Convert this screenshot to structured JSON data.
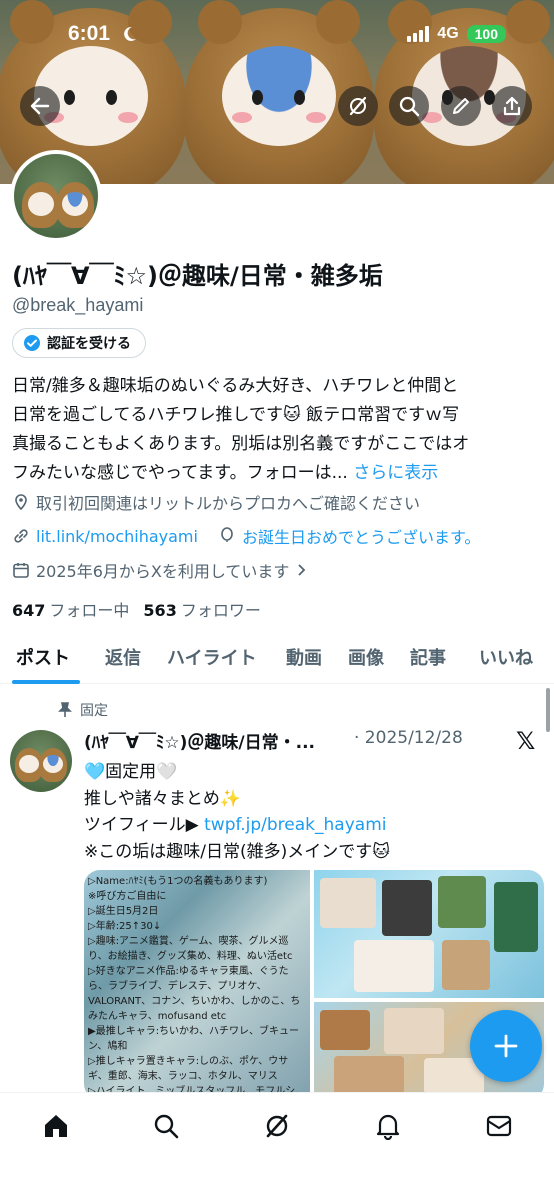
{
  "status_bar": {
    "time": "6:01",
    "network": "4G",
    "battery": "100"
  },
  "banner": {
    "icons": [
      "back-arrow-icon",
      "grok-icon",
      "search-icon",
      "edit-pencil-icon",
      "share-icon"
    ]
  },
  "profile": {
    "display_name": "(ﾊﾔ￣∀￣ﾐ☆)＠趣味/日常・雑多垢",
    "handle": "@break_hayami",
    "verify_label": "認証を受ける",
    "bio_lines": [
      "日常/雑多＆趣味垢のぬいぐるみ大好き、ハチワレと仲間と",
      "日常を過ごしてるハチワレ推しです🐱 飯テロ常習ですｗ写",
      "真撮ることもよくあります。別垢は別名義ですがここではオ",
      "フみたいな感じでやってます。フォローは..."
    ],
    "bio_more": "さらに表示",
    "location": "取引初回関連はリットルからプロカへご確認ください",
    "website": "lit.link/mochihayami",
    "birthday": "お誕生日おめでとうございます。",
    "joined": "2025年6月からXを利用しています",
    "following_count": "647",
    "following_label": "フォロー中",
    "followers_count": "563",
    "followers_label": "フォロワー"
  },
  "tabs": [
    "ポスト",
    "返信",
    "ハイライト",
    "動画",
    "画像",
    "記事",
    "いいね"
  ],
  "post": {
    "pinned_label": "固定",
    "author": "(ﾊﾔ￣∀￣ﾐ☆)＠趣味/日常・...",
    "date": "· 2025/12/28",
    "x_logo": "𝕏",
    "lines": [
      "🩵固定用🤍",
      "推しや諸々まとめ✨",
      "ツイフィール▶ "
    ],
    "twpf_link": "twpf.jp/break_hayami",
    "last_line": "※この垢は趣味/日常(雑多)メインです🐱",
    "media_text": "▷Name:ﾊﾔﾐ(もう1つの名義もあります)\n※呼び方ご自由に\n▷誕生日5月2日\n▷年齢:25↑30↓\n▷趣味:アニメ鑑賞、ゲーム、喫茶、グルメ巡り、お絵描き、グッズ集め、料理、ぬい活etc\n▷好きなアニメ作品:ゆるキャラ東風、ぐうたら、ラブライブ、デレステ、プリオケ、VALORANT、コナン、ちいかわ、しかのこ、ちみたんキャラ、mofusand etc\n▶最推しキャラ:ちいかわ、ハチワレ、ブキューン、鳩和\n▷推しキャラ置きキャラ:しのぶ、ポケ、ウサギ、重郎、海末、ラッコ、ホタル、マリス\n▷ハイライト、ミッブルスタッフル、モフルシ、大福、こんべいとう、ありぺんどう、クマ吉、ぜっか、シーサー、ひかり、ガイオラ&ネージュ、リッブル",
    "fab_label": "+"
  },
  "bottom_nav": [
    "home-icon",
    "search-icon",
    "grok-icon",
    "notifications-icon",
    "messages-icon"
  ],
  "colors": {
    "accent": "#1d9bf0",
    "text": "#0f1419",
    "secondary": "#536471",
    "verified": "#1d9bf0"
  }
}
